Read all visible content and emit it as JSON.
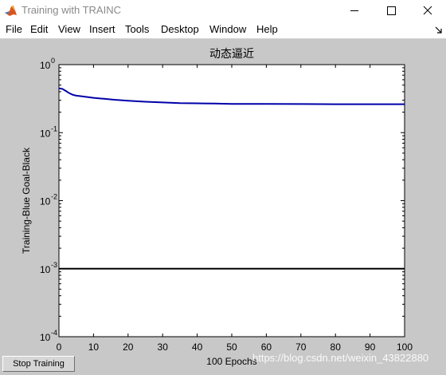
{
  "window": {
    "title": "Training with TRAINC"
  },
  "menu": [
    "File",
    "Edit",
    "View",
    "Insert",
    "Tools",
    "Desktop",
    "Window",
    "Help"
  ],
  "icons": {
    "app": "matlab-logo-icon",
    "minimize": "minimize-icon",
    "maximize": "maximize-icon",
    "close": "close-icon",
    "dock": "dock-arrow-icon"
  },
  "stop_button": {
    "label": "Stop Training"
  },
  "watermark": "https://blog.csdn.net/weixin_43822880",
  "chart_data": {
    "type": "line",
    "title": "动态逼近",
    "xlabel": "100 Epochs",
    "ylabel": "Training-Blue  Goal-Black",
    "xlim": [
      0,
      100
    ],
    "ylim": [
      0.0001,
      1
    ],
    "yscale": "log",
    "grid": false,
    "x_ticks": [
      0,
      10,
      20,
      30,
      40,
      50,
      60,
      70,
      80,
      90,
      100
    ],
    "y_ticks": [
      {
        "value": 1,
        "label_base": "10",
        "label_exp": "0"
      },
      {
        "value": 0.1,
        "label_base": "10",
        "label_exp": "-1"
      },
      {
        "value": 0.01,
        "label_base": "10",
        "label_exp": "-2"
      },
      {
        "value": 0.001,
        "label_base": "10",
        "label_exp": "-3"
      },
      {
        "value": 0.0001,
        "label_base": "10",
        "label_exp": "-4"
      }
    ],
    "series": [
      {
        "color": "#0000aa",
        "x": [
          0,
          1,
          2,
          3,
          4,
          5,
          6,
          8,
          10,
          13,
          16,
          20,
          25,
          30,
          35,
          40,
          45,
          50,
          60,
          70,
          80,
          90,
          100
        ],
        "y": [
          0.45,
          0.44,
          0.41,
          0.38,
          0.36,
          0.35,
          0.345,
          0.335,
          0.325,
          0.315,
          0.305,
          0.295,
          0.285,
          0.278,
          0.272,
          0.27,
          0.268,
          0.265,
          0.264,
          0.263,
          0.262,
          0.262,
          0.262
        ]
      },
      {
        "color": "#000000",
        "x": [
          0,
          100
        ],
        "y": [
          0.001,
          0.001
        ]
      }
    ]
  }
}
